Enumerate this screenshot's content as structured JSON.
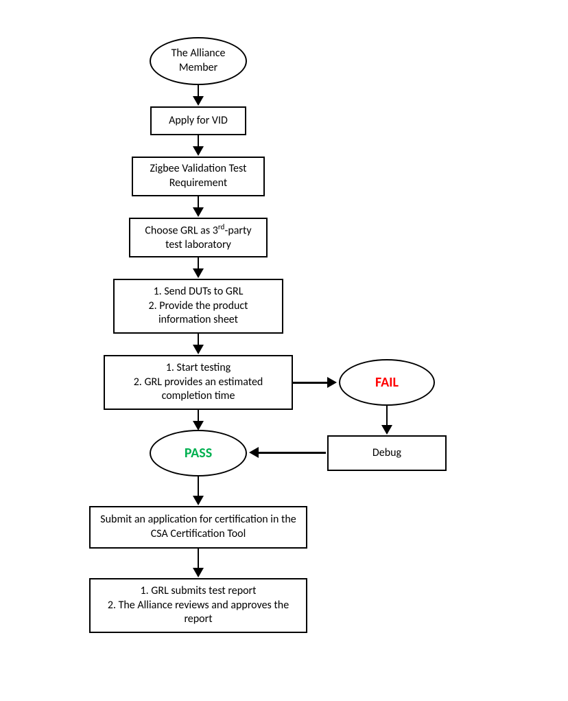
{
  "nodes": {
    "start": {
      "text": "The Alliance Member"
    },
    "apply_vid": {
      "text": "Apply for VID"
    },
    "zigbee_req": {
      "text": "Zigbee Validation Test Requirement"
    },
    "choose_grl": {
      "text_prefix": "Choose GRL as 3",
      "text_sup": "rd",
      "text_suffix": "-party test laboratory"
    },
    "send_duts": {
      "line1": "1. Send DUTs to GRL",
      "line2": "2. Provide the product information sheet"
    },
    "start_testing": {
      "line1": "1. Start testing",
      "line2": "2. GRL provides an estimated completion time"
    },
    "fail": {
      "text": "FAIL"
    },
    "pass": {
      "text": "PASS"
    },
    "debug": {
      "text": "Debug"
    },
    "submit_app": {
      "text": "Submit an application for certification in the CSA Certification Tool"
    },
    "grl_submits": {
      "line1": "1. GRL submits test report",
      "line2": "2. The Alliance reviews and approves the report"
    }
  }
}
